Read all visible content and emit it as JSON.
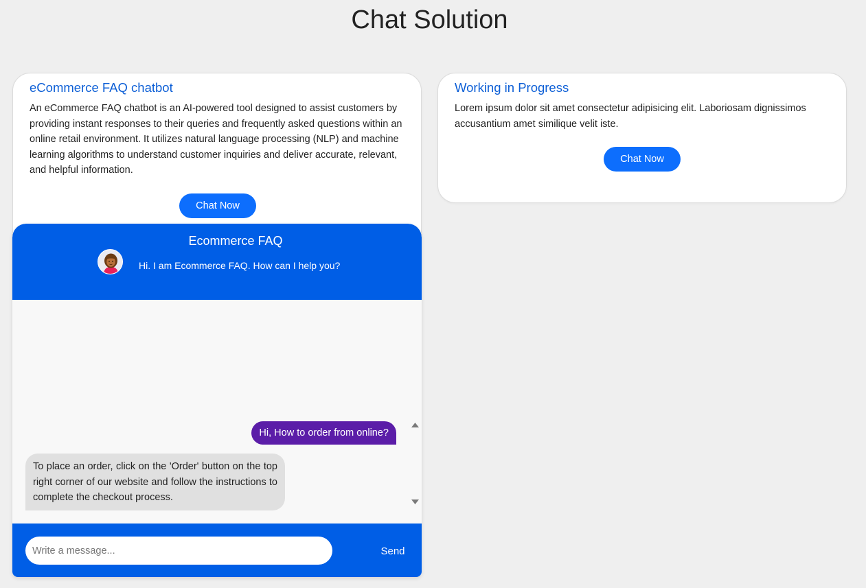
{
  "page": {
    "title": "Chat Solution"
  },
  "cards": [
    {
      "title": "eCommerce FAQ chatbot",
      "text": "An eCommerce FAQ chatbot is an AI-powered tool designed to assist customers by providing instant responses to their queries and frequently asked questions within an online retail environment. It utilizes natural language processing (NLP) and machine learning algorithms to understand customer inquiries and deliver accurate, relevant, and helpful information.",
      "button": "Chat Now"
    },
    {
      "title": "Working in Progress",
      "text": "Lorem ipsum dolor sit amet consectetur adipisicing elit. Laboriosam dignissimos accusantium amet similique velit iste.",
      "button": "Chat Now"
    }
  ],
  "chatbox": {
    "header_title": "Ecommerce FAQ",
    "header_greeting": "Hi. I am Ecommerce FAQ. How can I help you?",
    "avatar_icon": "person-avatar-icon",
    "messages": [
      {
        "sender": "user",
        "text": "Hi, How to order from online?"
      },
      {
        "sender": "bot",
        "text": "To place an order, click on the 'Order' button on the top right corner of our website and follow the instructions to complete the checkout process."
      }
    ],
    "input_placeholder": "Write a message...",
    "input_value": "",
    "send_label": "Send"
  },
  "colors": {
    "accent": "#005ee6",
    "button": "#0d6efd",
    "user_bubble": "#5b1da8",
    "bot_bubble": "#e0e0e0",
    "link_title": "#0d5fd6",
    "background": "#efefef"
  }
}
